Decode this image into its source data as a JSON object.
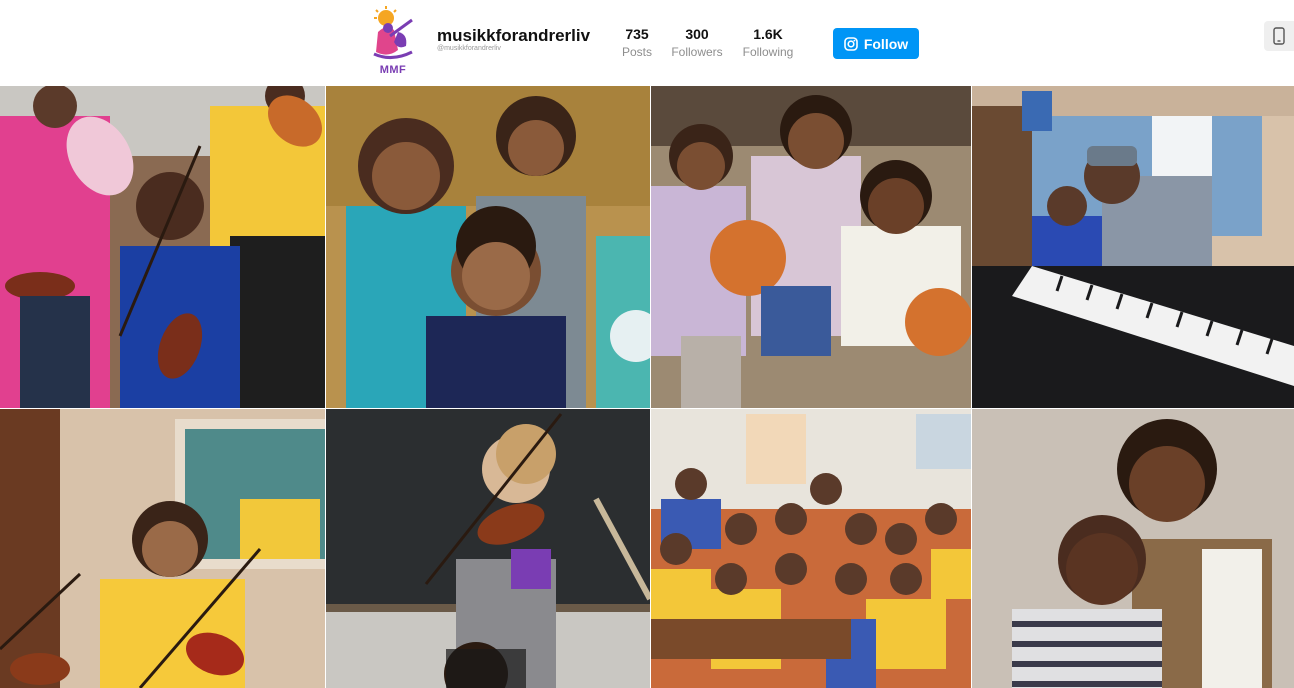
{
  "profile": {
    "username": "musikkforandrerliv",
    "handle": "@musikkforandrerliv",
    "logo_text": "MMF"
  },
  "stats": [
    {
      "value": "735",
      "label": "Posts"
    },
    {
      "value": "300",
      "label": "Followers"
    },
    {
      "value": "1.6K",
      "label": "Following"
    }
  ],
  "follow_label": "Follow",
  "colors": {
    "accent": "#0095f6",
    "logo_purple": "#7a3db3",
    "logo_pink": "#e0458c",
    "logo_orange": "#f5a623"
  },
  "icons": {
    "follow": "instagram-icon",
    "device": "phone-icon"
  }
}
